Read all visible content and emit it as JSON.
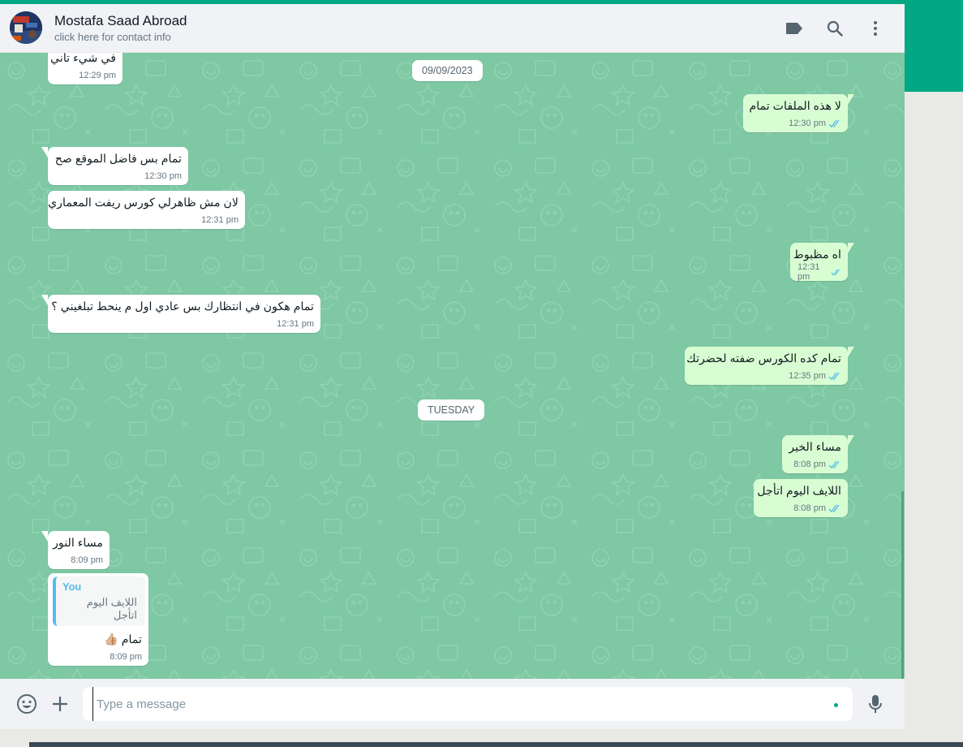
{
  "header": {
    "contact_name": "Mostafa Saad Abroad",
    "contact_subtitle": "click here for contact info",
    "icons": [
      "label-icon",
      "search-icon",
      "menu-icon"
    ]
  },
  "chat": {
    "date_chips": [
      "09/09/2023",
      "TUESDAY"
    ],
    "messages": [
      {
        "direction": "in",
        "text": "في شيء تاني",
        "time": "12:29 pm"
      },
      {
        "direction": "out",
        "text": "لا هذه الملفات تمام",
        "time": "12:30 pm",
        "status": "read"
      },
      {
        "direction": "in",
        "text": "تمام بس فاضل الموقع صح",
        "time": "12:30 pm"
      },
      {
        "direction": "in",
        "text": "لان مش ظاهرلي كورس ريفت المعماري",
        "time": "12:31 pm"
      },
      {
        "direction": "out",
        "text": "اه مظبوط",
        "time": "12:31 pm",
        "status": "read"
      },
      {
        "direction": "in",
        "text": "تمام هكون في انتظارك بس عادي اول م ينحط تبلغيني ؟",
        "time": "12:31 pm"
      },
      {
        "direction": "out",
        "text": "تمام كده الكورس ضفته لحضرتك",
        "time": "12:35 pm",
        "status": "read"
      },
      {
        "direction": "out",
        "text": "مساء الخير",
        "time": "8:08 pm",
        "status": "read"
      },
      {
        "direction": "out",
        "text": "اللايف اليوم اتأجل",
        "time": "8:08 pm",
        "status": "read"
      },
      {
        "direction": "in",
        "text": "مساء النور",
        "time": "8:09 pm"
      },
      {
        "direction": "in",
        "reply_author": "You",
        "reply_text": "اللايف اليوم اتأجل",
        "text": "تمام 👍🏼",
        "time": "8:09 pm"
      }
    ]
  },
  "composer": {
    "placeholder": "Type a message",
    "icons": [
      "emoji-icon",
      "plus-icon",
      "microphone-icon"
    ]
  },
  "colors": {
    "accent": "#00a884",
    "chat_background": "#7ec8a4",
    "outgoing_bubble": "#d9fdd3",
    "incoming_bubble": "#ffffff",
    "read_tick": "#53bdeb"
  }
}
